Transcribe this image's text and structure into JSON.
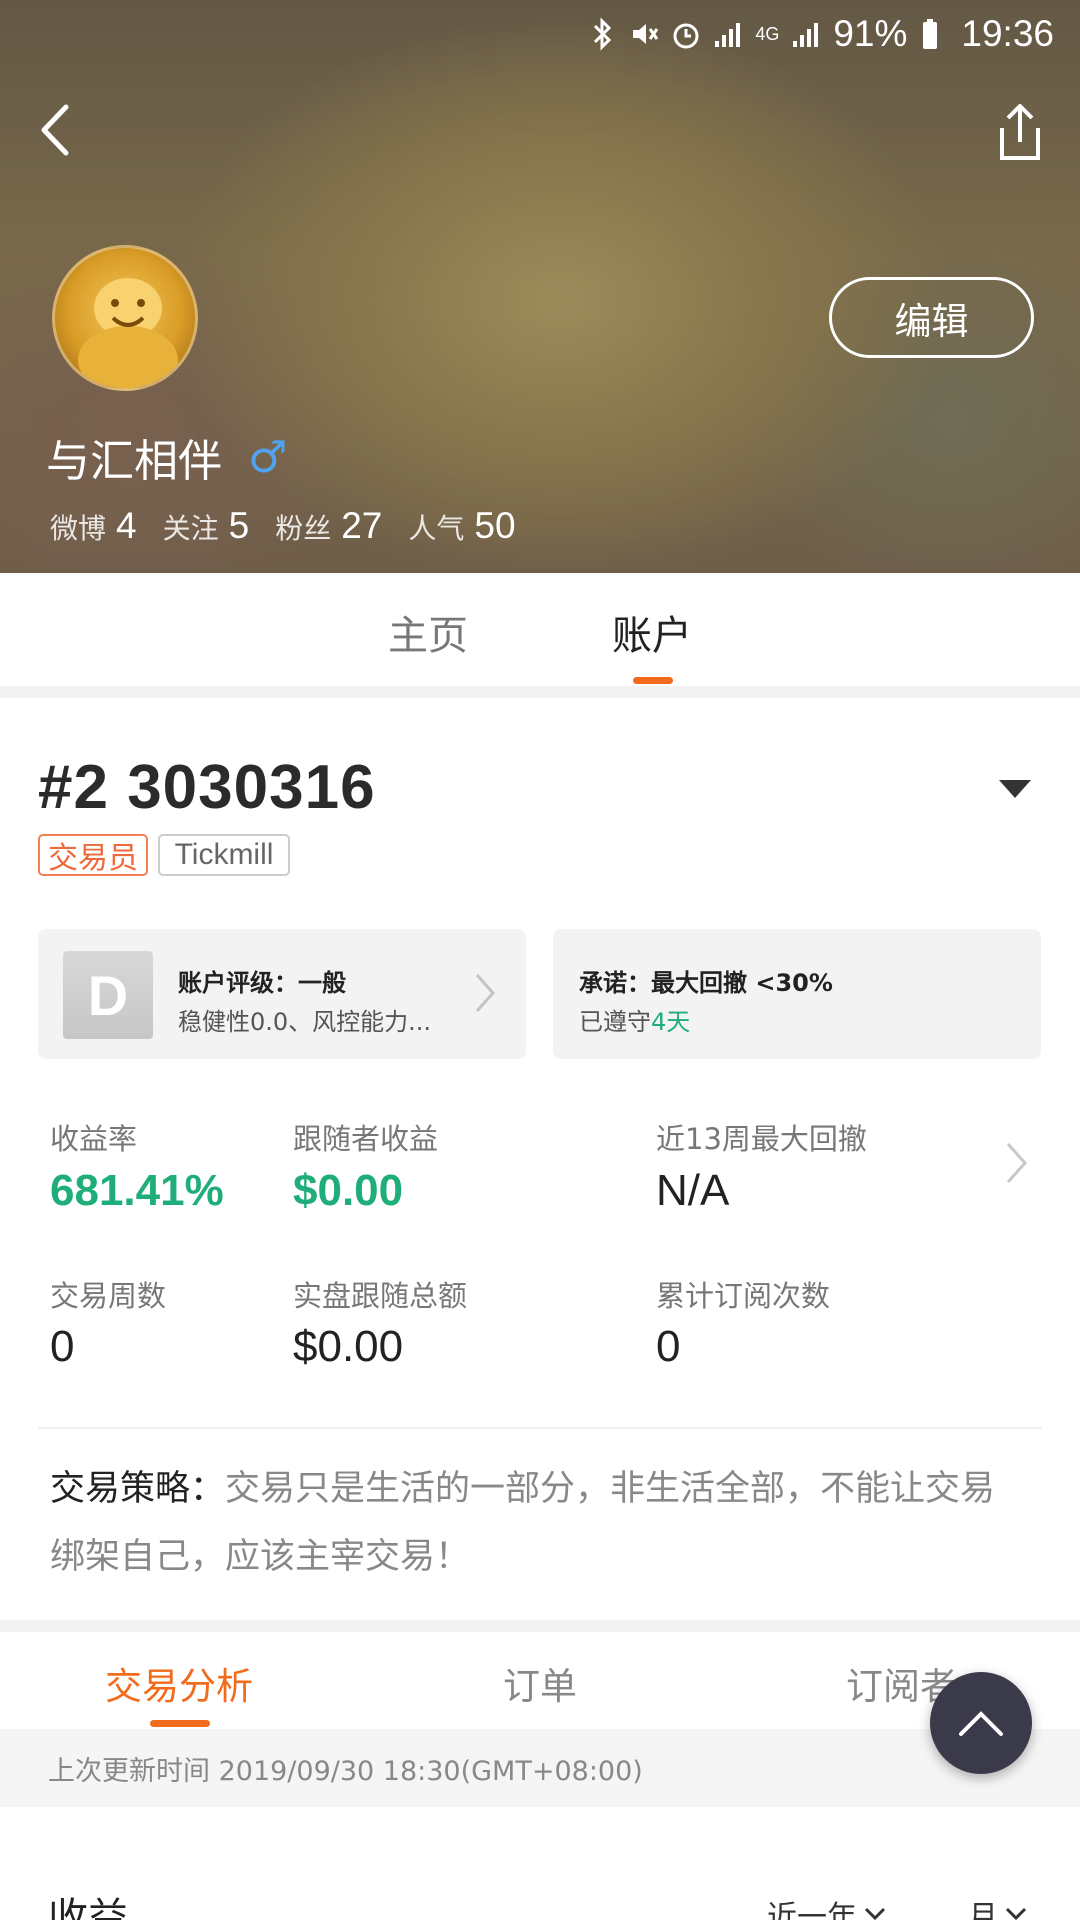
{
  "status_bar": {
    "battery": "91%",
    "time": "19:36",
    "network": "4G"
  },
  "header": {
    "edit_label": "编辑",
    "user_name": "与汇相伴",
    "gender_symbol": "♂",
    "stats": [
      {
        "label": "微博",
        "value": "4"
      },
      {
        "label": "关注",
        "value": "5"
      },
      {
        "label": "粉丝",
        "value": "27"
      },
      {
        "label": "人气",
        "value": "50"
      }
    ]
  },
  "profile_tabs": {
    "home": "主页",
    "account": "账户",
    "active": "account"
  },
  "account": {
    "number": "#2 3030316",
    "tags": {
      "role": "交易员",
      "broker": "Tickmill"
    },
    "rating_card": {
      "grade": "D",
      "title": "账户评级：一般",
      "subtitle": "稳健性0.0、风控能力..."
    },
    "promise_card": {
      "title": "承诺：最大回撤 <30%",
      "subtitle_prefix": "已遵守",
      "subtitle_value": "4天"
    },
    "metrics": [
      {
        "label": "收益率",
        "value": "681.41%"
      },
      {
        "label": "跟随者收益",
        "value": "$0.00"
      },
      {
        "label": "近13周最大回撤",
        "value": "N/A"
      },
      {
        "label": "交易周数",
        "value": "0"
      },
      {
        "label": "实盘跟随总额",
        "value": "$0.00"
      },
      {
        "label": "累计订阅次数",
        "value": "0"
      }
    ],
    "strategy_label": "交易策略：",
    "strategy_text": "交易只是生活的一部分，非生活全部，不能让交易绑架自己，应该主宰交易！"
  },
  "analysis_tabs": {
    "analysis": "交易分析",
    "orders": "订单",
    "subscribers": "订阅者",
    "active": "analysis"
  },
  "update_time": "上次更新时间 2019/09/30 18:30(GMT+08:00)",
  "income": {
    "title": "收益",
    "period": "近一年",
    "unit": "月"
  },
  "colors": {
    "accent": "#f26b1d",
    "positive": "#1fae7a",
    "male": "#4fa3f0"
  }
}
